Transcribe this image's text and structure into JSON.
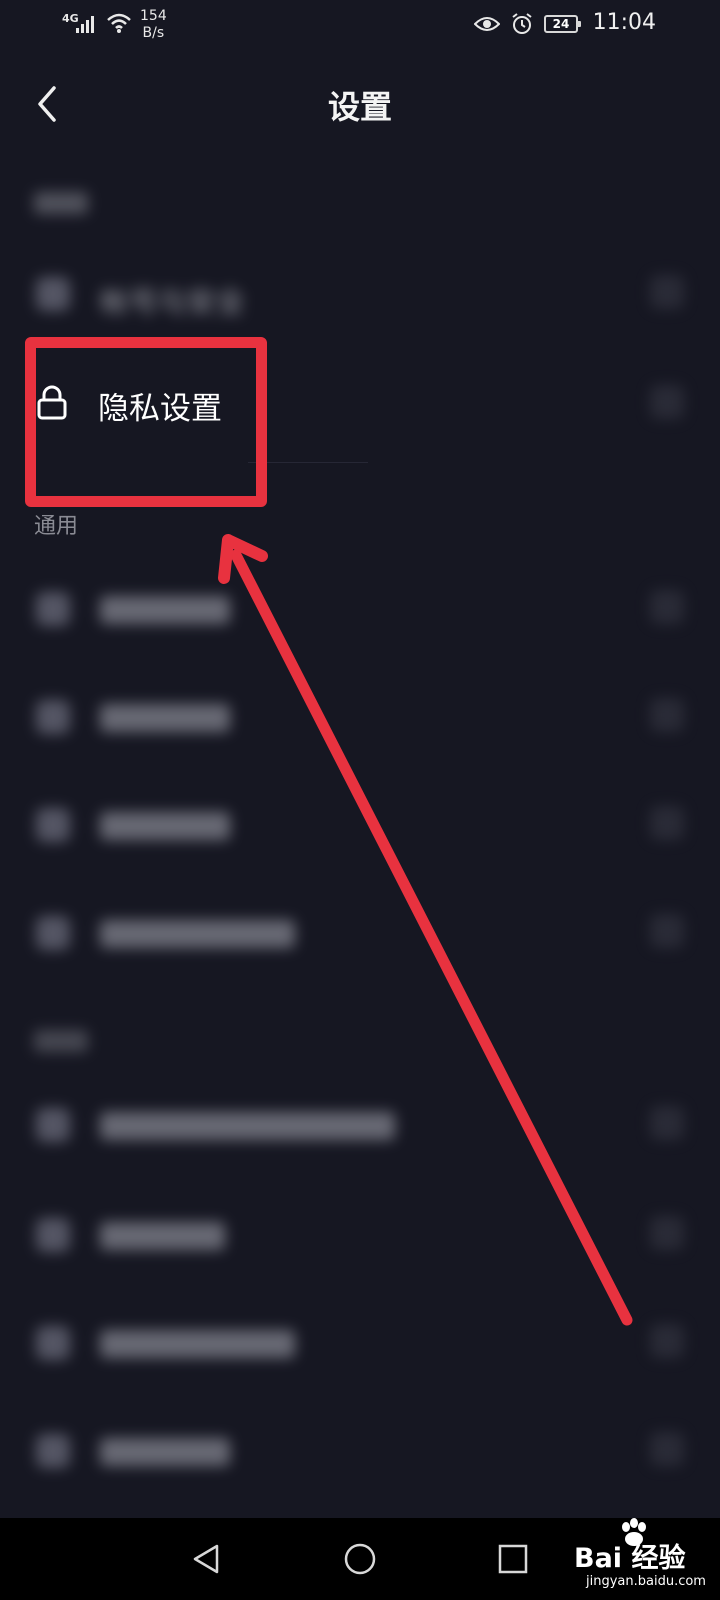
{
  "status_bar": {
    "network": "4G",
    "speed_value": "154",
    "speed_unit": "B/s",
    "battery": "24",
    "time": "11:04"
  },
  "header": {
    "title": "设置"
  },
  "privacy_item": {
    "label": "隐私设置"
  },
  "sections": {
    "general": "通用"
  },
  "blurred_text": {
    "account_item": "帐号与安全"
  },
  "watermark": {
    "brand": "Bai 经验",
    "url": "jingyan.baidu.com"
  },
  "colors": {
    "background": "#161722",
    "highlight": "#e8323f"
  }
}
